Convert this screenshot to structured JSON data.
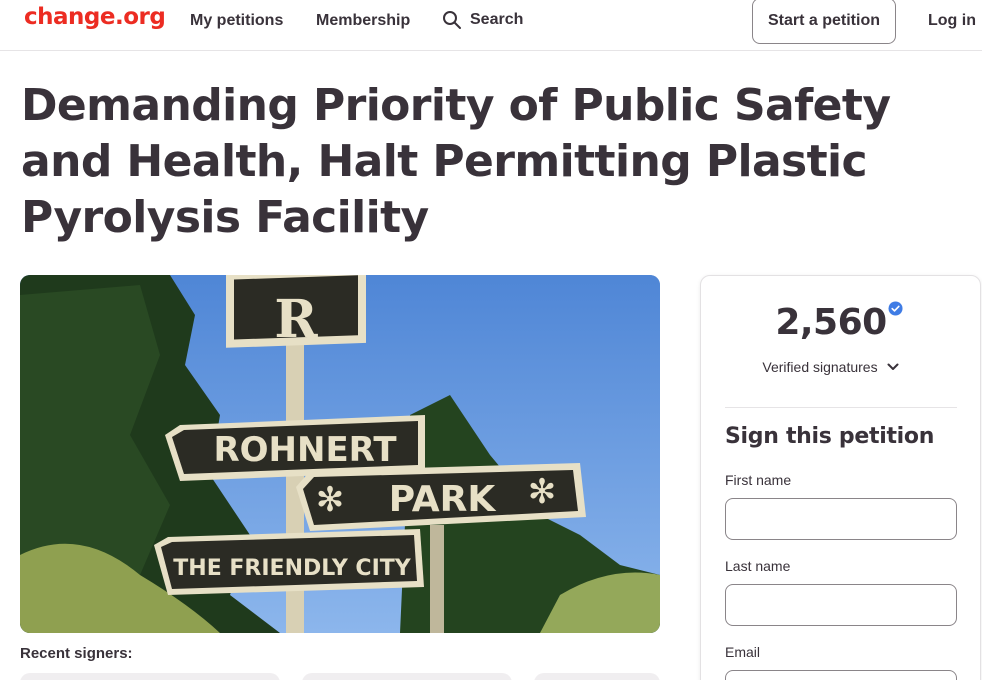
{
  "header": {
    "logo": "change.org",
    "nav": [
      "My petitions",
      "Membership",
      "Search"
    ],
    "start_petition": "Start a petition",
    "login": "Log in"
  },
  "petition": {
    "title": "Demanding Priority of Public Safety and Health, Halt Permitting Plastic Pyrolysis Facility",
    "image": {
      "sign_texts": [
        "R",
        "ROHNERT",
        "PARK",
        "THE FRIENDLY CITY"
      ],
      "icon": "rohnert-park-sign-photo"
    },
    "recent_signers_label": "Recent signers:"
  },
  "signature_panel": {
    "count": "2,560",
    "verified_label": "Verified signatures",
    "sign_title": "Sign this petition",
    "fields": [
      {
        "label": "First name",
        "value": "",
        "placeholder": ""
      },
      {
        "label": "Last name",
        "value": "",
        "placeholder": ""
      },
      {
        "label": "Email",
        "value": "",
        "placeholder": ""
      }
    ]
  },
  "colors": {
    "brand": "#ec2c22",
    "text": "#39323a",
    "verified": "#3f7ce5",
    "border": "#8a8589"
  }
}
